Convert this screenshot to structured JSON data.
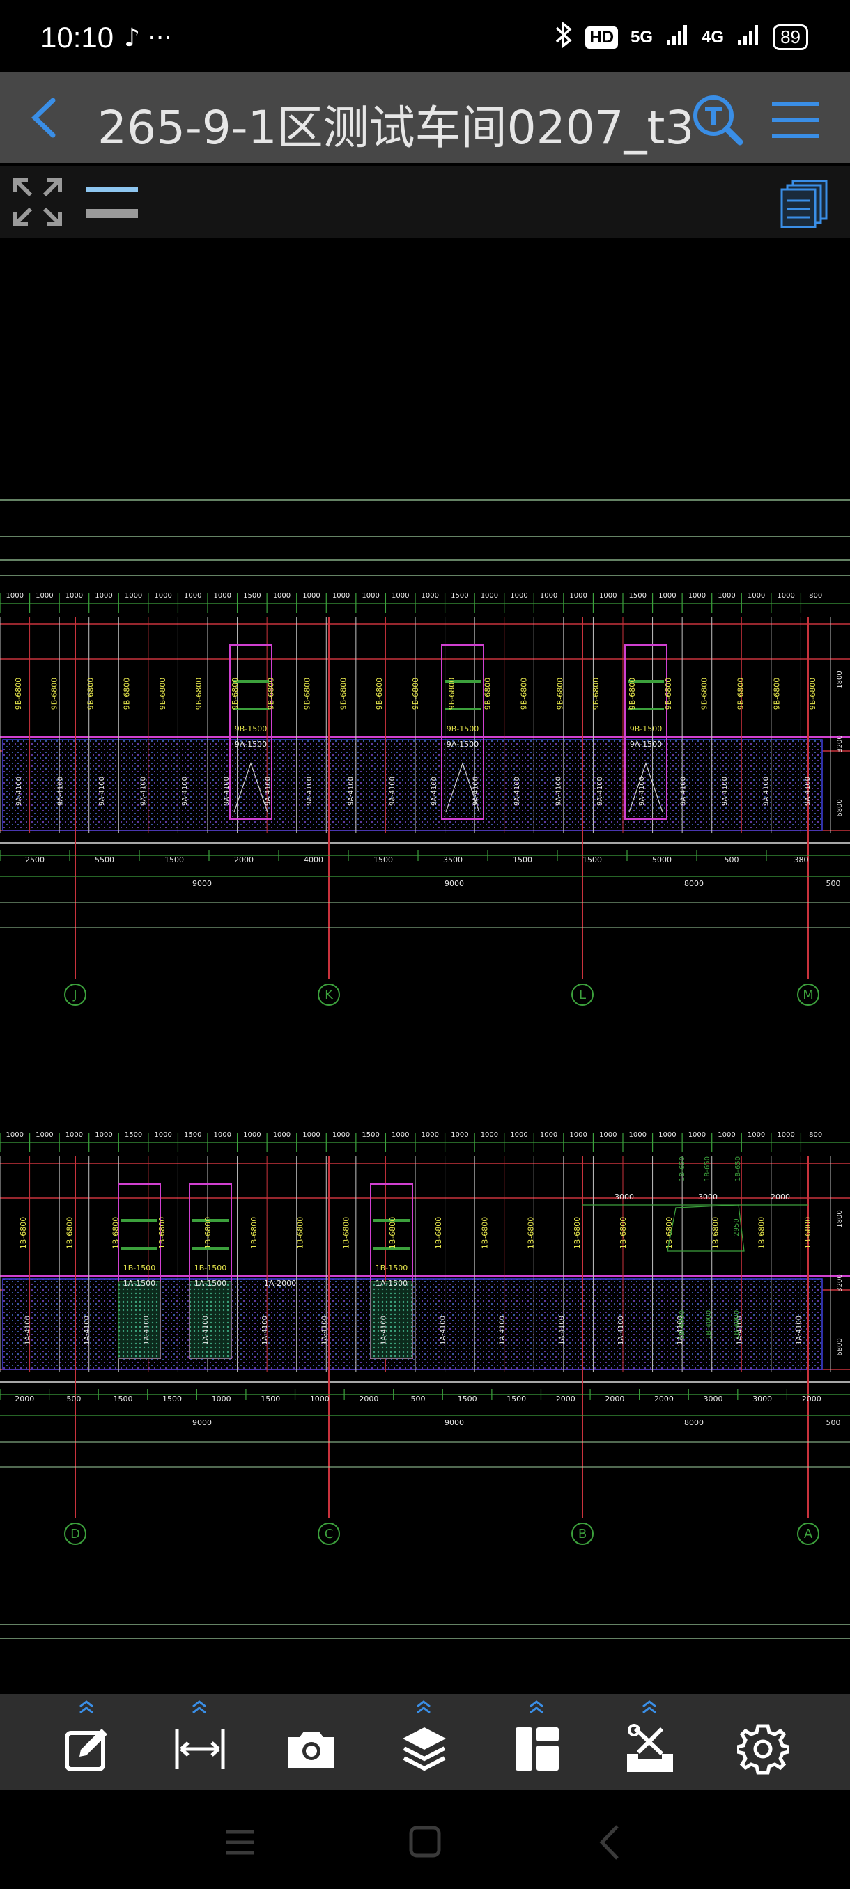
{
  "status_bar": {
    "time": "10:10",
    "left_icons": "♪ ···",
    "hd": "HD",
    "net1": "5G",
    "net2": "4G",
    "battery": "89"
  },
  "title_bar": {
    "title": "265-9-1区测试车间0207_t3",
    "back_icon": "chevron-left-icon",
    "search_icon": "text-search-icon",
    "menu_icon": "hamburger-menu-icon"
  },
  "colors": {
    "accent": "#3a8ee6",
    "titlebar_bg": "#474747",
    "bottombar_bg": "#2e2e2e",
    "cad_red": "#c8323c",
    "cad_green": "#3ca03c",
    "cad_magenta": "#d040d0",
    "cad_blue": "#4040e0",
    "cad_yellow": "#e6e64c"
  },
  "drawing": {
    "upper": {
      "top_dims": [
        "1000",
        "1000",
        "1000",
        "1000",
        "1000",
        "1000",
        "1000",
        "1000",
        "1500",
        "1000",
        "1000",
        "1000",
        "1000",
        "1000",
        "1000",
        "1500",
        "1000",
        "1000",
        "1000",
        "1000",
        "1000",
        "1500",
        "1000",
        "1000",
        "1000",
        "1000",
        "1000",
        "800"
      ],
      "top_labels": [
        "9B-6800",
        "9B-6800",
        "9B-6800",
        "9B-6800",
        "9B-6800",
        "9B-6800",
        "9B-6800",
        "9B-6800",
        "9B-6800",
        "9B-6800",
        "9B-6800",
        "9B-6800",
        "9B-6800",
        "9B-6800",
        "9B-6800",
        "9B-6800",
        "9B-6800",
        "9B-6800",
        "9B-6800",
        "9B-6800",
        "9B-6800",
        "9B-6800",
        "9B-6800"
      ],
      "door_labels": [
        "9B-1500",
        "9B-1500",
        "9B-1500"
      ],
      "door_labels_a": [
        "9A-1500",
        "9A-1500",
        "9A-1500"
      ],
      "bottom_labels": [
        "9A-4100",
        "9A-4100",
        "9A-4100",
        "9A-4100",
        "9A-4100",
        "9A-4100",
        "9A-4100",
        "9A-4100",
        "9A-4100",
        "9A-4100",
        "9A-4100",
        "9A-4100",
        "9A-4100",
        "9A-4100",
        "9A-4100",
        "9A-4100",
        "9A-4100",
        "9A-4100",
        "9A-4100",
        "9A-4100"
      ],
      "right_dims": [
        "1800",
        "3200",
        "6800"
      ],
      "dims_row1": [
        "2500",
        "5500",
        "1500",
        "2000",
        "4000",
        "1500",
        "3500",
        "1500",
        "1500",
        "5000",
        "500",
        "380"
      ],
      "dims_row2": [
        "9000",
        "9000",
        "8000",
        "500"
      ],
      "axes": [
        "J",
        "K",
        "L",
        "M"
      ]
    },
    "lower": {
      "top_dims": [
        "1000",
        "1000",
        "1000",
        "1000",
        "1500",
        "1000",
        "1500",
        "1000",
        "1000",
        "1000",
        "1000",
        "1000",
        "1500",
        "1000",
        "1000",
        "1000",
        "1000",
        "1000",
        "1000",
        "1000",
        "1000",
        "1000",
        "1000",
        "1000",
        "1000",
        "1000",
        "1000",
        "800"
      ],
      "top_labels": [
        "1B-6800",
        "1B-6800",
        "1B-6800",
        "1B-6800",
        "1B-6800",
        "1B-6800",
        "1B-6800",
        "1B-6800",
        "1B-6800",
        "1B-6800",
        "1B-6800",
        "1B-6800",
        "1B-6800",
        "1B-6800",
        "1B-6800",
        "1B-6800",
        "1B-6800",
        "1B-6800"
      ],
      "mid_labels": [
        "1B-4000",
        "1B-4000",
        "1B-4000"
      ],
      "right_top_dims": [
        "3000",
        "3000",
        "2000"
      ],
      "small_labels": [
        "1B-650",
        "1B-650",
        "1B-650",
        "2950"
      ],
      "door_labels": [
        "1B-1500",
        "1B-1500",
        "1B-1500"
      ],
      "door_labels_a": [
        "1A-1500",
        "1A-1500",
        "1A-2000",
        "1A-1500"
      ],
      "bottom_labels": [
        "1A-4100",
        "1A-4100",
        "1A-4100",
        "1A-4100",
        "1A-4100",
        "1A-4100",
        "1A-4100",
        "1A-4100",
        "1A-4100",
        "1A-4100",
        "1A-4100",
        "1A-4100",
        "1A-4100",
        "1A-4100"
      ],
      "right_dims": [
        "1800",
        "3200",
        "6800"
      ],
      "dims_row1": [
        "2000",
        "500",
        "1500",
        "1500",
        "1000",
        "1500",
        "1000",
        "2000",
        "500",
        "1500",
        "1500",
        "2000",
        "2000",
        "2000",
        "3000",
        "3000",
        "2000"
      ],
      "dims_row2": [
        "9000",
        "9000",
        "8000",
        "500"
      ],
      "axes": [
        "D",
        "C",
        "B",
        "A"
      ]
    }
  },
  "bottom_toolbar": {
    "tools": [
      {
        "icon": "edit-icon",
        "has_chevron": true
      },
      {
        "icon": "measure-icon",
        "has_chevron": true
      },
      {
        "icon": "camera-icon",
        "has_chevron": false
      },
      {
        "icon": "layers-icon",
        "has_chevron": true
      },
      {
        "icon": "layout-icon",
        "has_chevron": true
      },
      {
        "icon": "tools-icon",
        "has_chevron": true
      },
      {
        "icon": "settings-icon",
        "has_chevron": false
      }
    ]
  },
  "nav_bar": {
    "recent_icon": "recent-apps-icon",
    "home_icon": "home-icon",
    "back_icon": "back-icon"
  }
}
